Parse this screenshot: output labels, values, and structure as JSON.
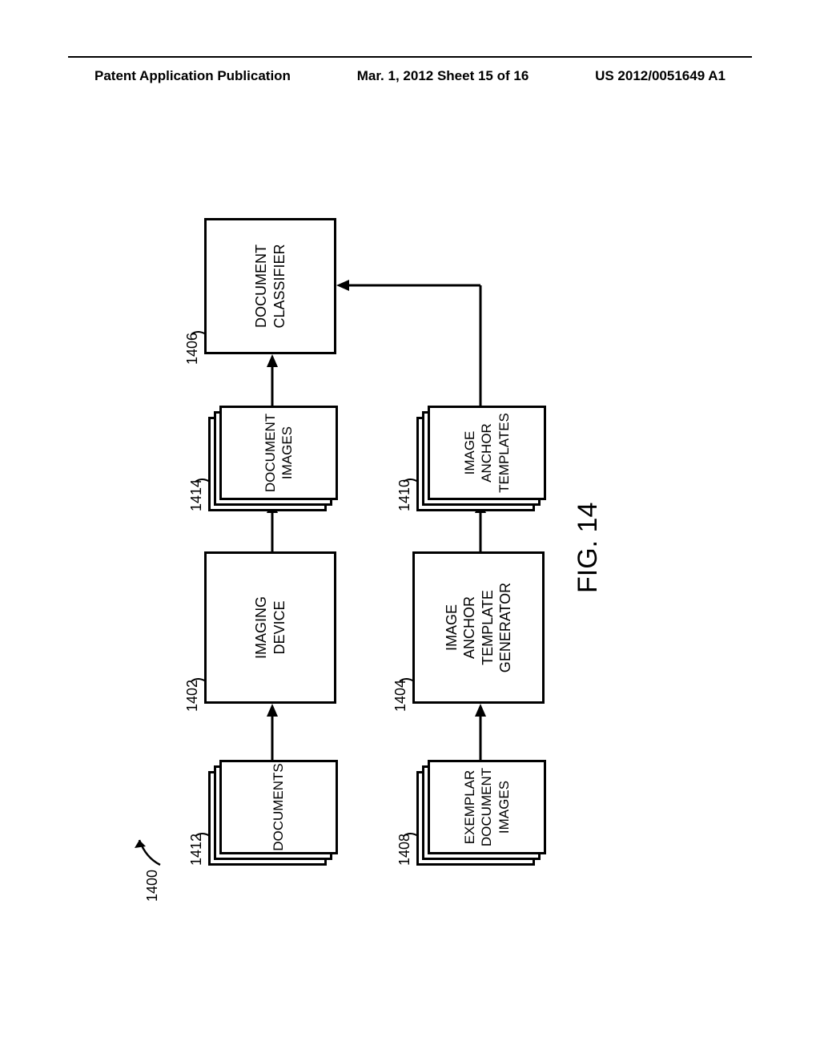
{
  "header": {
    "left": "Patent Application Publication",
    "center": "Mar. 1, 2012  Sheet 15 of 16",
    "right": "US 2012/0051649 A1"
  },
  "figure": {
    "ref_overall": "1400",
    "fig_label": "FIG. 14",
    "blocks": {
      "documents": {
        "ref": "1412",
        "text": "DOCUMENTS"
      },
      "imaging_device": {
        "ref": "1402",
        "text": "IMAGING\nDEVICE"
      },
      "document_images": {
        "ref": "1414",
        "text": "DOCUMENT\nIMAGES"
      },
      "document_classifier": {
        "ref": "1406",
        "text": "DOCUMENT\nCLASSIFIER"
      },
      "exemplar_images": {
        "ref": "1408",
        "text": "EXEMPLAR\nDOCUMENT\nIMAGES"
      },
      "template_generator": {
        "ref": "1404",
        "text": "IMAGE\nANCHOR\nTEMPLATE\nGENERATOR"
      },
      "anchor_templates": {
        "ref": "1410",
        "text": "IMAGE\nANCHOR\nTEMPLATES"
      }
    }
  }
}
